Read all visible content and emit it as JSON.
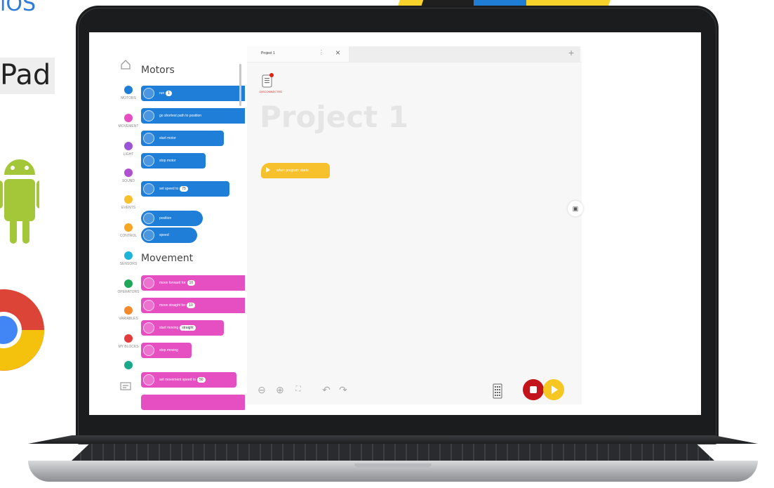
{
  "marketing": {
    "ios_label": "iOS",
    "ipad_label": "Pad",
    "android_icon": "android-logo",
    "chrome_icon": "chrome-logo"
  },
  "app": {
    "project_tab_title": "Project 1",
    "project_title": "Project 1",
    "device_label": "DISCONNECTED",
    "hat_block_label": "when program starts",
    "categories": [
      {
        "label": "MOTORS",
        "color": "#1f7ed8"
      },
      {
        "label": "MOVEMENT",
        "color": "#e64fc2"
      },
      {
        "label": "LIGHT",
        "color": "#9a55d6"
      },
      {
        "label": "SOUND",
        "color": "#b04fd0"
      },
      {
        "label": "EVENTS",
        "color": "#f6c12c"
      },
      {
        "label": "CONTROL",
        "color": "#f5a623"
      },
      {
        "label": "SENSORS",
        "color": "#1fb5d8"
      },
      {
        "label": "OPERATORS",
        "color": "#20a85a"
      },
      {
        "label": "VARIABLES",
        "color": "#f5892b"
      },
      {
        "label": "MY BLOCKS",
        "color": "#e43c3c"
      },
      {
        "label": "",
        "color": "#1aa88c"
      }
    ],
    "palette": {
      "motors_heading": "Motors",
      "movement_heading": "Movement",
      "motor_blocks": [
        {
          "text": "run",
          "pill": "1"
        },
        {
          "text": "go shortest path to position",
          "pill": ""
        },
        {
          "text": "start motor",
          "pill": ""
        },
        {
          "text": "stop motor",
          "pill": ""
        },
        {
          "text": "set speed to",
          "pill": "75"
        },
        {
          "text": "position",
          "pill": ""
        },
        {
          "text": "speed",
          "pill": ""
        }
      ],
      "movement_blocks": [
        {
          "text": "move forward for",
          "pill": "10"
        },
        {
          "text": "move straight for",
          "pill": "10"
        },
        {
          "text": "start moving",
          "pill": "straight"
        },
        {
          "text": "stop moving",
          "pill": ""
        },
        {
          "text": "set movement speed to",
          "pill": "50"
        }
      ]
    },
    "colors": {
      "stop": "#c4141b",
      "play": "#f6c623",
      "motors": "#1f7ed8",
      "movement": "#e64fc2"
    }
  }
}
